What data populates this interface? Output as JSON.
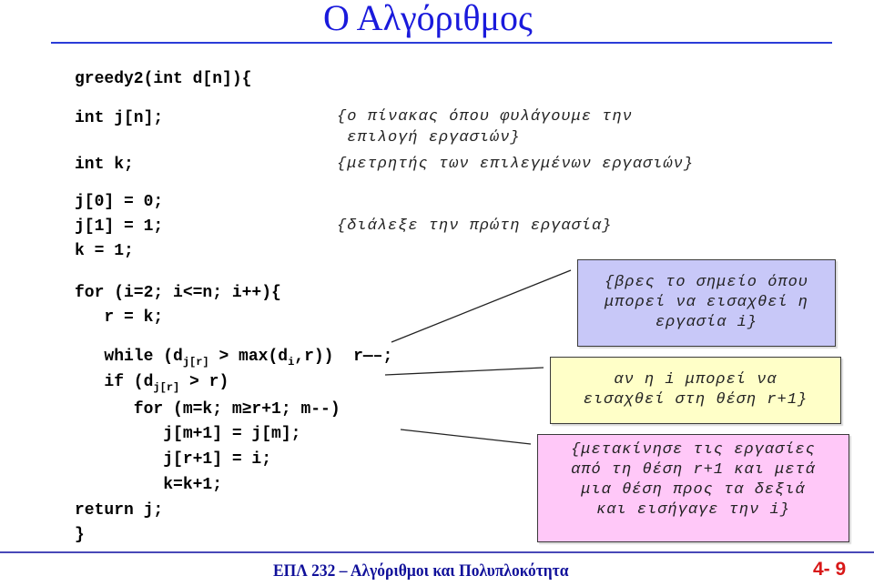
{
  "slide": {
    "title": "Ο Αλγόριθμος",
    "footer": "ΕΠΛ 232 – Αλγόριθμοι και Πολυπλοκότητα",
    "page_number": "4- 9"
  },
  "code": {
    "signature": "greedy2(int d[n]){",
    "decl_j": "int j[n];",
    "decl_k": "int k;",
    "init_j0": "j[0] = 0;",
    "init_j1": "j[1] = 1;",
    "init_k": "k = 1;",
    "for_outer": "for (i=2; i<=n; i++){",
    "assign_r": "   r = k;",
    "while_pre": "   while (d",
    "while_sub1": "j[r]",
    "while_mid": " > max(d",
    "while_sub2": "i",
    "while_post": ",r))  r—–;",
    "if_pre": "   if (d",
    "if_sub": "j[r]",
    "if_post": " > r)",
    "for_inner": "      for (m=k; m≥r+1; m--)",
    "shift": "         j[m+1] = j[m];",
    "insert": "         j[r+1] = i;",
    "incr": "         k=k+1;",
    "return": "return j;",
    "close": "}"
  },
  "comments": {
    "array_line1": "{ο πίνακας όπου φυλάγουμε την",
    "array_line2": " επιλογή εργασιών}",
    "counter": "{μετρητής των επιλεγμένων εργασιών}",
    "first": "{διάλεξε την πρώτη εργασία}"
  },
  "callouts": {
    "find": {
      "lines": [
        "{βρες το σημείο όπου",
        "μπορεί να εισαχθεί η",
        "εργασία i}"
      ],
      "color": "#c8c8f8"
    },
    "if": {
      "lines": [
        "αν η i μπορεί να",
        "εισαχθεί στη θέση r+1}"
      ],
      "color": "#ffffc8"
    },
    "shift": {
      "lines": [
        "{μετακίνησε τις εργασίες",
        "από τη θέση r+1 και μετά",
        "μια θέση προς τα δεξιά",
        "και εισήγαγε την i}"
      ],
      "color": "#ffc8f8"
    }
  },
  "colors": {
    "title": "#1a1adc",
    "footer": "#10109a",
    "page_number": "#d81818"
  }
}
